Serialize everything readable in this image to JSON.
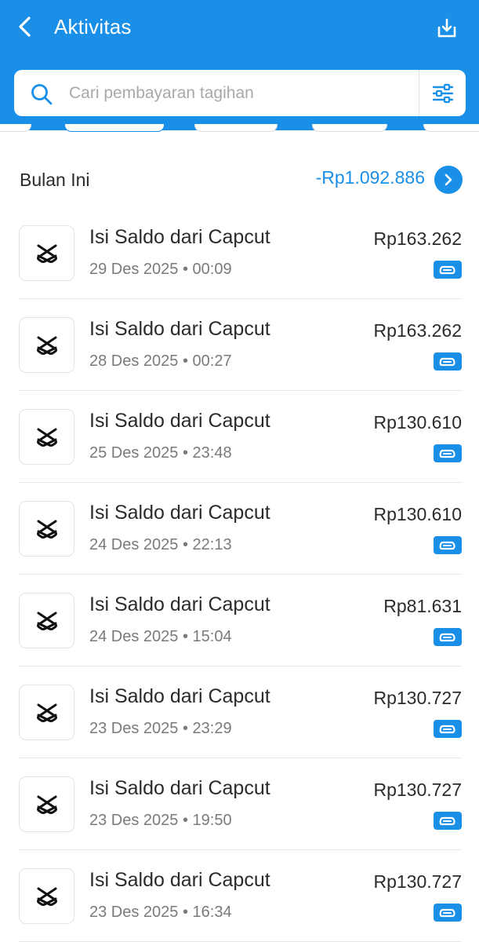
{
  "header": {
    "title": "Aktivitas",
    "back_icon": "chevron-left-icon",
    "download_icon": "download-icon",
    "background": "#1a8fe8"
  },
  "search": {
    "placeholder": "Cari pembayaran tagihan",
    "value": "",
    "filter_icon": "filter-sliders-icon"
  },
  "summary": {
    "label": "Bulan Ini",
    "total": "-Rp1.092.886",
    "accent": "#1a8fe8"
  },
  "transactions": [
    {
      "title": "Isi Saldo dari Capcut",
      "date": "29 Des 2025 • 00:09",
      "amount": "Rp163.262",
      "logo": "capcut-logo-icon",
      "badge": "wallet-icon"
    },
    {
      "title": "Isi Saldo dari Capcut",
      "date": "28 Des 2025 • 00:27",
      "amount": "Rp163.262",
      "logo": "capcut-logo-icon",
      "badge": "wallet-icon"
    },
    {
      "title": "Isi Saldo dari Capcut",
      "date": "25 Des 2025 • 23:48",
      "amount": "Rp130.610",
      "logo": "capcut-logo-icon",
      "badge": "wallet-icon"
    },
    {
      "title": "Isi Saldo dari Capcut",
      "date": "24 Des 2025 • 22:13",
      "amount": "Rp130.610",
      "logo": "capcut-logo-icon",
      "badge": "wallet-icon"
    },
    {
      "title": "Isi Saldo dari Capcut",
      "date": "24 Des 2025 • 15:04",
      "amount": "Rp81.631",
      "logo": "capcut-logo-icon",
      "badge": "wallet-icon"
    },
    {
      "title": "Isi Saldo dari Capcut",
      "date": "23 Des 2025 • 23:29",
      "amount": "Rp130.727",
      "logo": "capcut-logo-icon",
      "badge": "wallet-icon"
    },
    {
      "title": "Isi Saldo dari Capcut",
      "date": "23 Des 2025 • 19:50",
      "amount": "Rp130.727",
      "logo": "capcut-logo-icon",
      "badge": "wallet-icon"
    },
    {
      "title": "Isi Saldo dari Capcut",
      "date": "23 Des 2025 • 16:34",
      "amount": "Rp130.727",
      "logo": "capcut-logo-icon",
      "badge": "wallet-icon"
    }
  ]
}
